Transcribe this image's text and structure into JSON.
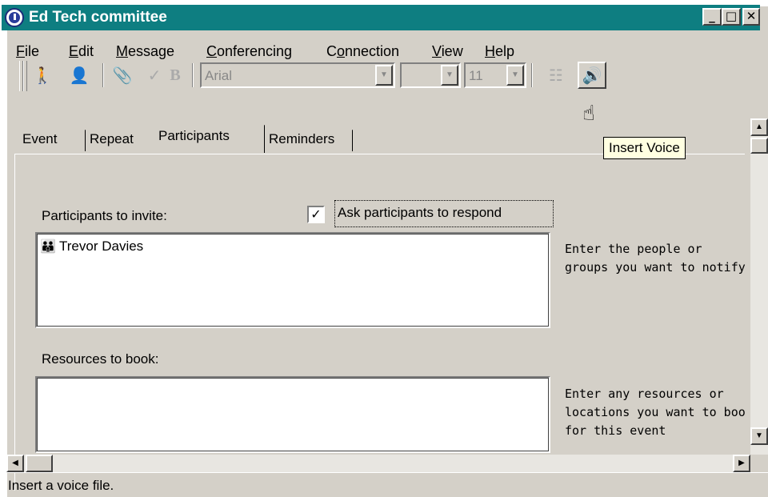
{
  "window": {
    "title": "Ed Tech committee",
    "controls": {
      "minimize": "_",
      "maximize": "□",
      "close": "✕"
    }
  },
  "menu": [
    {
      "label": "File",
      "mnemonic": "F",
      "rest": "ile"
    },
    {
      "label": "Edit",
      "mnemonic": "E",
      "rest": "dit"
    },
    {
      "label": "Message",
      "mnemonic": "M",
      "rest": "essage"
    },
    {
      "label": "Conferencing",
      "mnemonic": "C",
      "rest": "onferencing"
    },
    {
      "label": "Connection",
      "mnemonic": "o",
      "pre": "C",
      "rest": "nnection"
    },
    {
      "label": "View",
      "mnemonic": "V",
      "rest": "iew"
    },
    {
      "label": "Help",
      "mnemonic": "H",
      "rest": "elp"
    }
  ],
  "toolbar": {
    "font_name": "Arial",
    "font_style": "",
    "font_size": "11",
    "bold_glyph": "B",
    "icons": [
      "send-icon",
      "address-book-icon",
      "attach-icon",
      "spell-check-icon",
      "bold-icon",
      "properties-icon",
      "insert-voice-icon"
    ]
  },
  "tooltip": "Insert Voice",
  "tabs": [
    "Event",
    "Repeat",
    "Participants",
    "Reminders"
  ],
  "active_tab": "Participants",
  "participants": {
    "label": "Participants to invite:",
    "ask_respond_label": "Ask participants to respond",
    "ask_respond_checked": true,
    "items": [
      "Trevor Davies"
    ],
    "hint_line1": "Enter the people or",
    "hint_line2": "groups you want to notify"
  },
  "resources": {
    "label": "Resources to book:",
    "items": [],
    "hint_line1": "Enter any resources or",
    "hint_line2": "locations you want to boo",
    "hint_line3": "for this event"
  },
  "status": "Insert a voice file."
}
